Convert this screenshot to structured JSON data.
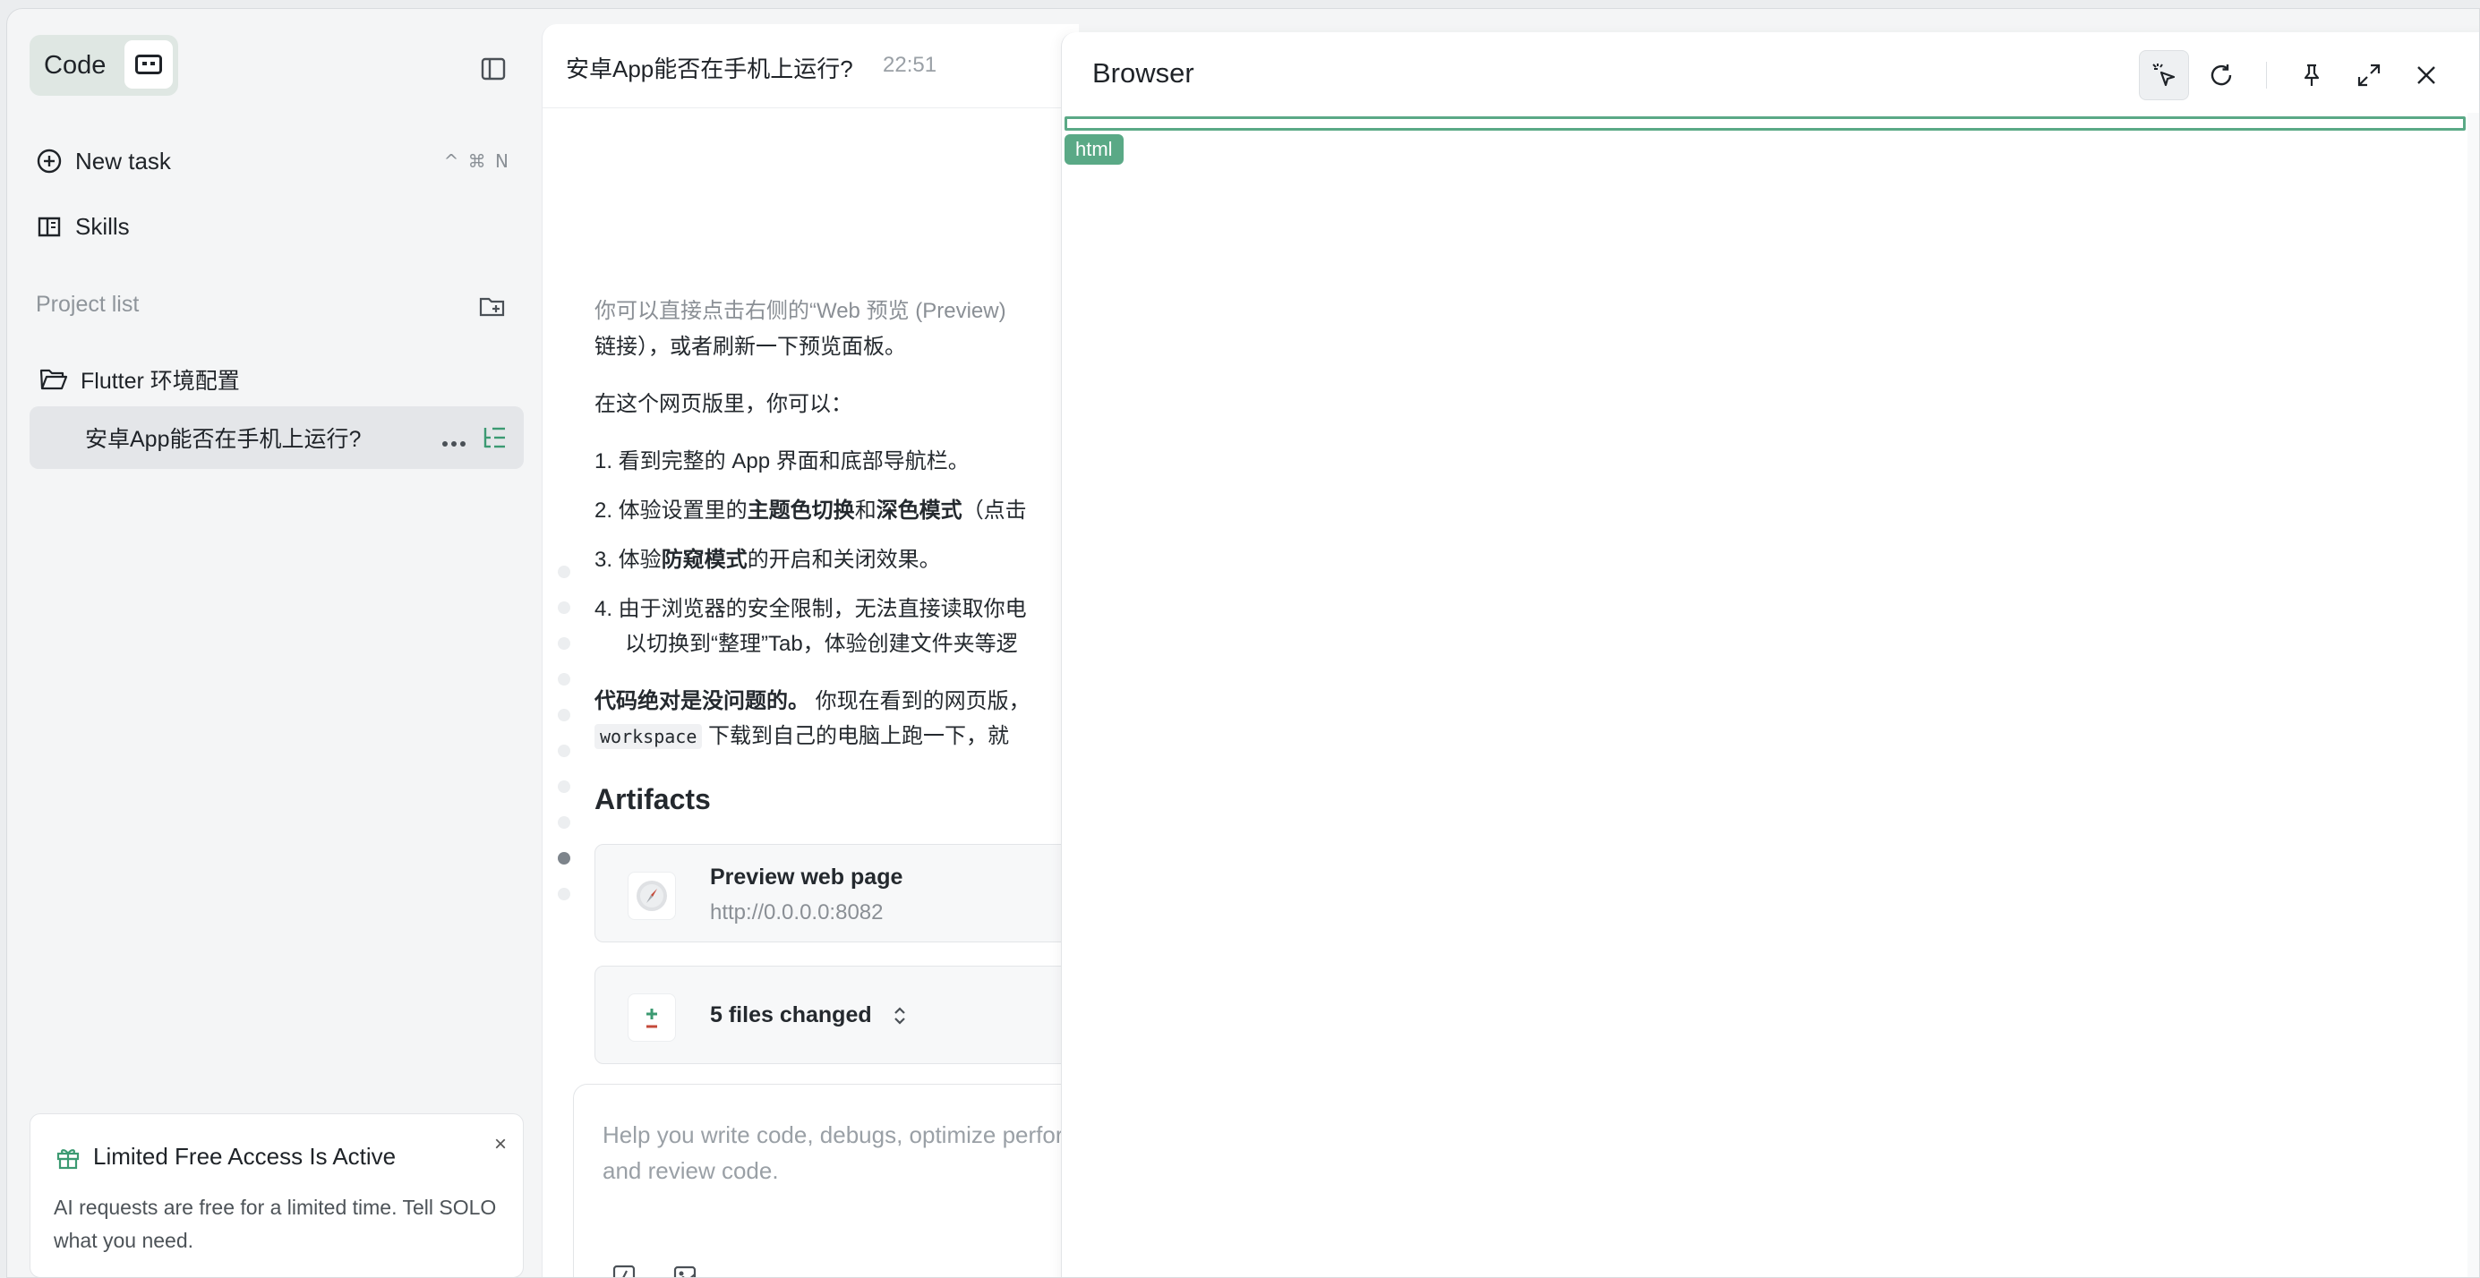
{
  "sidebar": {
    "code_label": "Code",
    "nav": [
      {
        "label": "New task",
        "shortcut": "^ ⌘ N"
      },
      {
        "label": "Skills",
        "shortcut": ""
      }
    ],
    "project_list_label": "Project list",
    "folder": {
      "label": "Flutter 环境配置"
    },
    "active_task": {
      "label": "安卓App能否在手机上运行?"
    },
    "promo": {
      "title": "Limited Free Access Is Active",
      "body": "AI requests are free for a limited time. Tell SOLO what you need.",
      "close": "×"
    }
  },
  "chat": {
    "title": "安卓App能否在手机上运行?",
    "time": "22:51",
    "messages": {
      "p1_a": "你可以直接点击右侧的“Web 预览 (Preview)",
      "p1_b": "链接），或者刷新一下预览面板。",
      "p2": "在这个网页版里，你可以：",
      "li1": "1. 看到完整的 App 界面和底部导航栏。",
      "li2_a": "2. 体验设置里的",
      "li2_b": "主题色切换",
      "li2_c": "和",
      "li2_d": "深色模式",
      "li2_e": "（点击",
      "li3_a": "3. 体验",
      "li3_b": "防窥模式",
      "li3_c": "的开启和关闭效果。",
      "li4_a": "4. 由于浏览器的安全限制，无法直接读取你电",
      "li4_b": "以切换到“整理”Tab，体验创建文件夹等逻",
      "p3_bold": "代码绝对是没问题的。",
      "p3_rest": " 你现在看到的网页版，",
      "p3_code": "workspace",
      "p3_tail": " 下载到自己的电脑上跑一下，就"
    },
    "artifacts_title": "Artifacts",
    "artifacts": [
      {
        "title": "Preview web page",
        "subtitle": "http://0.0.0.0:8082"
      },
      {
        "title": "5 files changed"
      }
    ],
    "composer_placeholder": "Help you write code, debugs, optimize performance and review code."
  },
  "browser": {
    "title": "Browser",
    "element_tag": "html"
  },
  "colors": {
    "accent": "#5aa986",
    "promo_gift": "#3c9a72",
    "sidebar_bg": "#f4f5f6"
  }
}
